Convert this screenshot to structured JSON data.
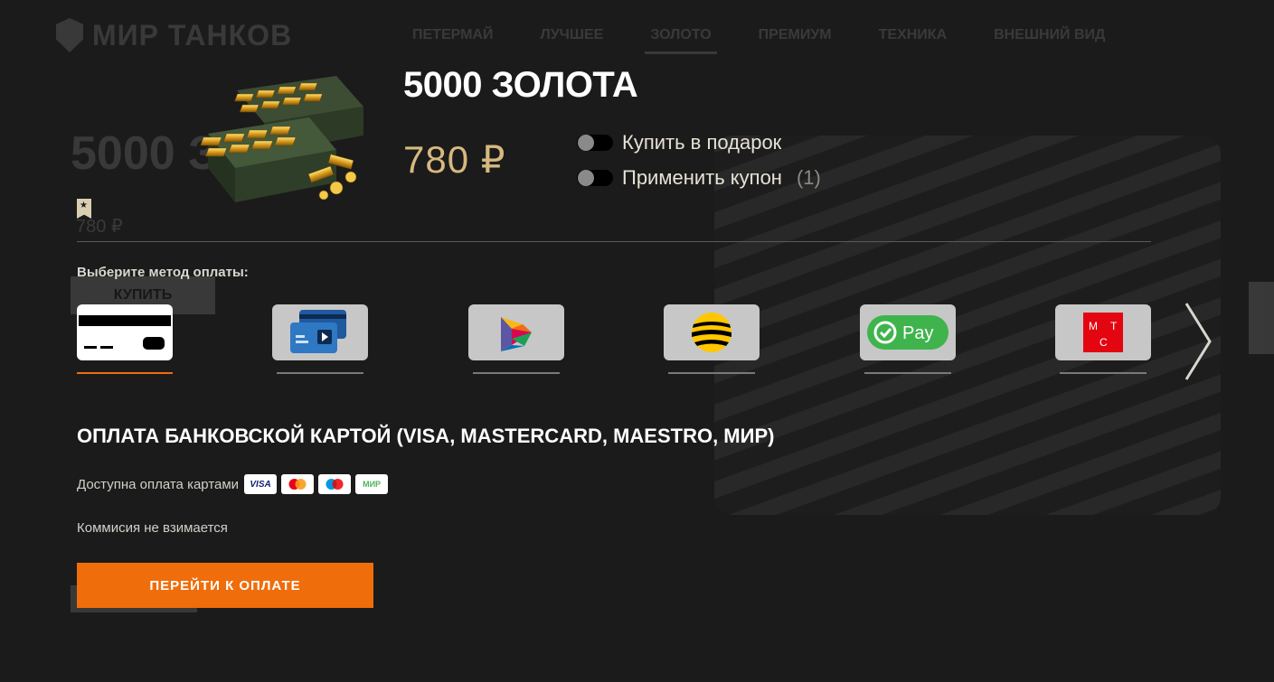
{
  "background": {
    "logo_text": "МИР ТАНКОВ",
    "nav": [
      "ПЕТЕРМАЙ",
      "ЛУЧШЕЕ",
      "ЗОЛОТО",
      "ПРЕМИУМ",
      "ТЕХНИКА",
      "ВНЕШНИЙ ВИД"
    ],
    "active_nav": "ЗОЛОТО",
    "heading": "5000 ЗО",
    "price": "780 ₽",
    "buy_label": "КУПИТЬ"
  },
  "product": {
    "title": "5000 ЗОЛОТА",
    "price": "780 ₽",
    "image_icon": "gold-crates-icon",
    "badge_icon": "bookmark-star-icon"
  },
  "options": {
    "gift_label": "Купить в подарок",
    "gift_enabled": false,
    "coupon_label": "Применить купон",
    "coupon_count": "(1)",
    "coupon_enabled": false
  },
  "payment": {
    "choose_label": "Выберите метод оплаты:",
    "methods": [
      {
        "icon": "bank-card-icon",
        "selected": true
      },
      {
        "icon": "sbp-cards-icon",
        "selected": false
      },
      {
        "icon": "sbp-logo-icon",
        "selected": false
      },
      {
        "icon": "beeline-icon",
        "selected": false
      },
      {
        "icon": "sber-pay-icon",
        "label": "Pay",
        "selected": false
      },
      {
        "icon": "mts-icon",
        "label": "МТС",
        "selected": false
      }
    ],
    "next_icon": "chevron-right-icon",
    "section_title": "ОПЛАТА БАНКОВСКОЙ КАРТОЙ (VISA, MASTERCARD, MAESTRO, МИР)",
    "cards_label": "Доступна оплата картами",
    "card_brands": [
      "VISA",
      "mastercard",
      "maestro",
      "МИР"
    ],
    "commission": "Коммисия не взимается",
    "pay_button": "Перейти к оплате"
  },
  "colors": {
    "accent": "#f06d0b",
    "price": "#d6b97f",
    "background": "#1b1b1b"
  }
}
